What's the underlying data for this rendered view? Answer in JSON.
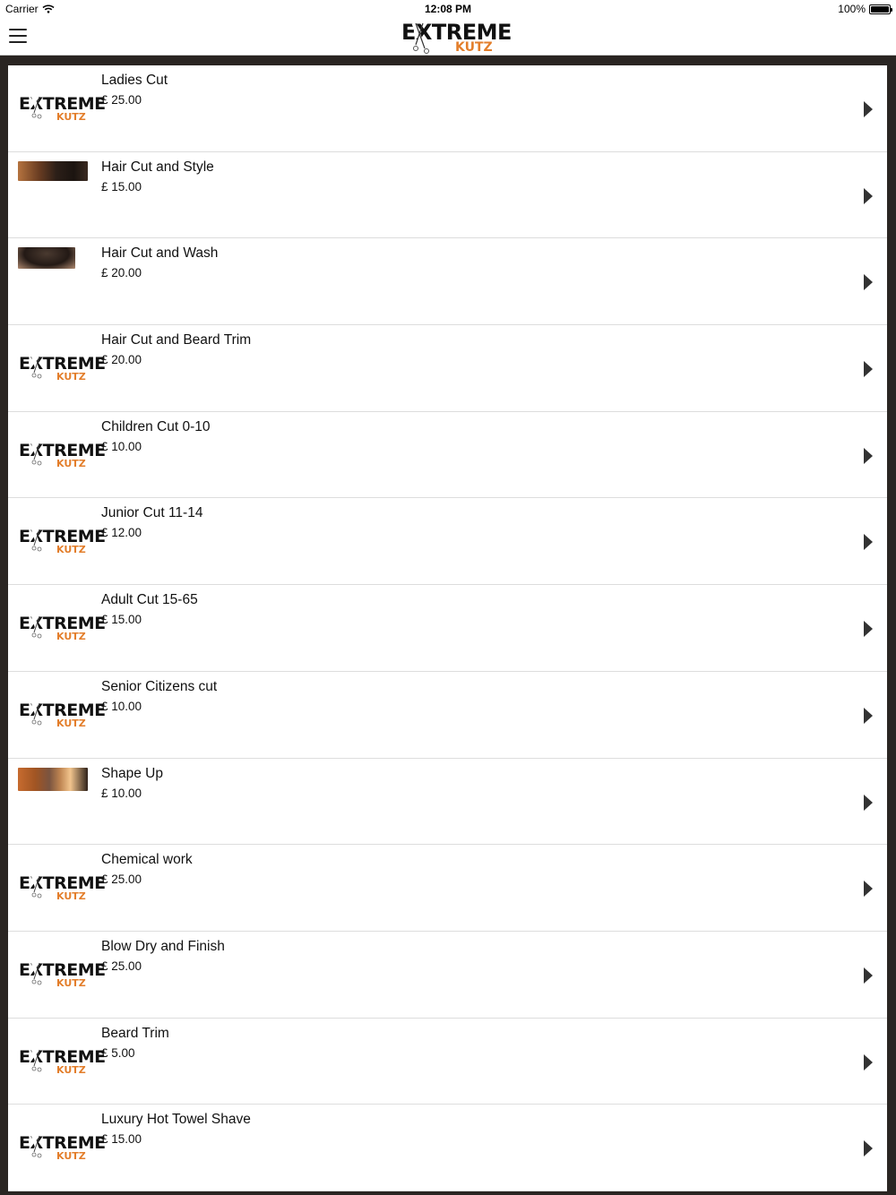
{
  "status_bar": {
    "carrier": "Carrier",
    "time": "12:08 PM",
    "battery": "100%"
  },
  "header": {
    "brand_main": "EXTREME",
    "brand_sub": "KUTZ"
  },
  "services": [
    {
      "title": "Ladies Cut",
      "price": "£ 25.00",
      "thumb": "logo"
    },
    {
      "title": "Hair Cut and Style",
      "price": "£ 15.00",
      "thumb": "photo1"
    },
    {
      "title": "Hair Cut and Wash",
      "price": "£ 20.00",
      "thumb": "photo2"
    },
    {
      "title": "Hair Cut and Beard Trim",
      "price": "£ 20.00",
      "thumb": "logo"
    },
    {
      "title": "Children Cut 0-10",
      "price": "£ 10.00",
      "thumb": "logo"
    },
    {
      "title": "Junior Cut 11-14",
      "price": "£ 12.00",
      "thumb": "logo"
    },
    {
      "title": "Adult Cut 15-65",
      "price": "£ 15.00",
      "thumb": "logo"
    },
    {
      "title": "Senior Citizens cut",
      "price": "£ 10.00",
      "thumb": "logo"
    },
    {
      "title": "Shape Up",
      "price": "£ 10.00",
      "thumb": "photo3"
    },
    {
      "title": "Chemical work",
      "price": "£ 25.00",
      "thumb": "logo"
    },
    {
      "title": "Blow Dry and Finish",
      "price": "£ 25.00",
      "thumb": "logo"
    },
    {
      "title": "Beard Trim",
      "price": "£ 5.00",
      "thumb": "logo"
    },
    {
      "title": "Luxury Hot Towel Shave",
      "price": "£ 15.00",
      "thumb": "logo"
    }
  ],
  "colors": {
    "accent": "#e37e2b",
    "background": "#2a2522"
  }
}
